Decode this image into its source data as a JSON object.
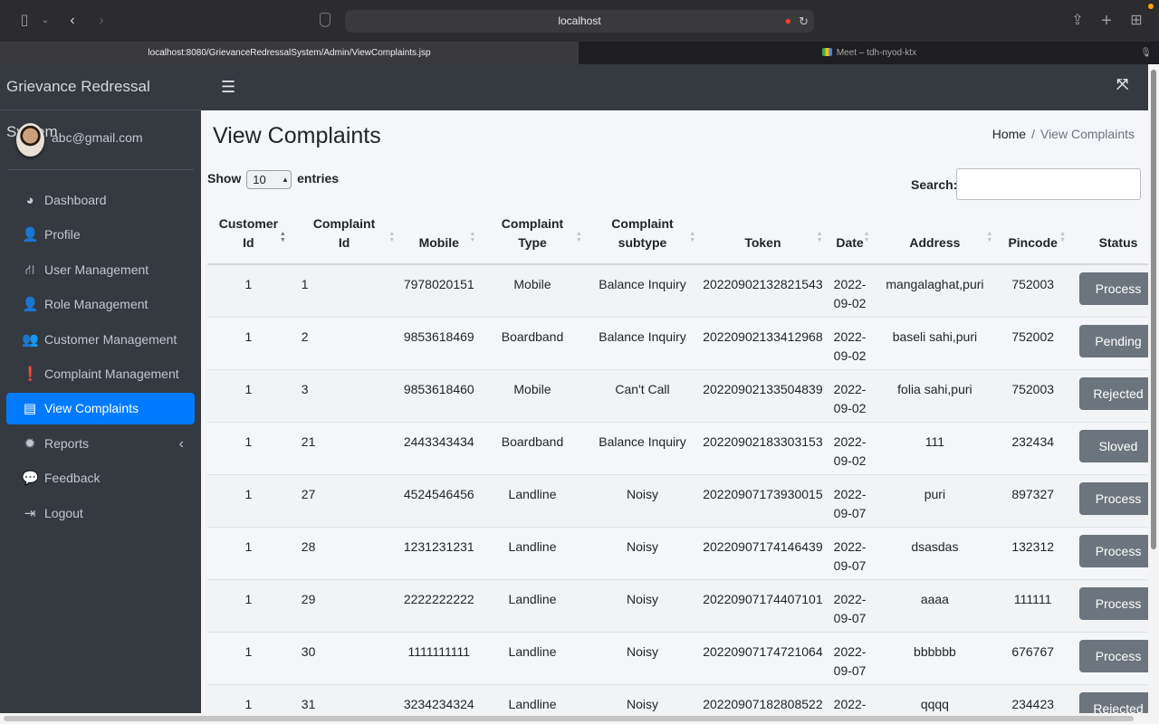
{
  "browser": {
    "url_display": "localhost",
    "active_tab": "localhost:8080/GrievanceRedressalSystem/Admin/ViewComplaints.jsp",
    "inactive_tab": "Meet – tdh-nyod-ktx"
  },
  "app": {
    "brand": "Grievance Redressal System"
  },
  "user": {
    "email": "abc@gmail.com"
  },
  "sidebar": {
    "items": [
      {
        "label": "Dashboard",
        "icon": "dashboard-icon",
        "glyph": "◕"
      },
      {
        "label": "Profile",
        "icon": "user-icon",
        "glyph": "👤"
      },
      {
        "label": "User Management",
        "icon": "sitemap-icon",
        "glyph": "⛙"
      },
      {
        "label": "Role Management",
        "icon": "user-tie-icon",
        "glyph": "👤"
      },
      {
        "label": "Customer Management",
        "icon": "users-icon",
        "glyph": "👥"
      },
      {
        "label": "Complaint Management",
        "icon": "exclamation-circle-icon",
        "glyph": "❗"
      },
      {
        "label": "View Complaints",
        "icon": "list-alt-icon",
        "glyph": "▤"
      },
      {
        "label": "Reports",
        "icon": "bug-icon",
        "glyph": "✹"
      },
      {
        "label": "Feedback",
        "icon": "comment-icon",
        "glyph": "💬"
      },
      {
        "label": "Logout",
        "icon": "sign-out-icon",
        "glyph": "⇥"
      }
    ],
    "active_index": 6
  },
  "page": {
    "title": "View Complaints",
    "breadcrumb": {
      "home": "Home",
      "current": "View Complaints",
      "separator": "/"
    }
  },
  "table_controls": {
    "show_label": "Show",
    "entries_value": "10",
    "entries_label": "entries",
    "search_label": "Search:",
    "search_value": ""
  },
  "table": {
    "columns": [
      {
        "line1": "Customer",
        "line2": "Id"
      },
      {
        "line1": "Complaint",
        "line2": "Id"
      },
      {
        "line1": "",
        "line2": "Mobile"
      },
      {
        "line1": "Complaint",
        "line2": "Type"
      },
      {
        "line1": "Complaint",
        "line2": "subtype"
      },
      {
        "line1": "",
        "line2": "Token"
      },
      {
        "line1": "",
        "line2": "Date"
      },
      {
        "line1": "",
        "line2": "Address"
      },
      {
        "line1": "",
        "line2": "Pincode"
      },
      {
        "line1": "",
        "line2": "Status"
      }
    ],
    "rows": [
      {
        "customer_id": "1",
        "complaint_id": "1",
        "mobile": "7978020151",
        "type": "Mobile",
        "subtype": "Balance Inquiry",
        "token": "20220902132821543",
        "date1": "2022-",
        "date2": "09-02",
        "address": "mangalaghat,puri",
        "pincode": "752003",
        "status": "Process"
      },
      {
        "customer_id": "1",
        "complaint_id": "2",
        "mobile": "9853618469",
        "type": "Boardband",
        "subtype": "Balance Inquiry",
        "token": "20220902133412968",
        "date1": "2022-",
        "date2": "09-02",
        "address": "baseli sahi,puri",
        "pincode": "752002",
        "status": "Pending"
      },
      {
        "customer_id": "1",
        "complaint_id": "3",
        "mobile": "9853618460",
        "type": "Mobile",
        "subtype": "Can't Call",
        "token": "20220902133504839",
        "date1": "2022-",
        "date2": "09-02",
        "address": "folia sahi,puri",
        "pincode": "752003",
        "status": "Rejected"
      },
      {
        "customer_id": "1",
        "complaint_id": "21",
        "mobile": "2443343434",
        "type": "Boardband",
        "subtype": "Balance Inquiry",
        "token": "20220902183303153",
        "date1": "2022-",
        "date2": "09-02",
        "address": "111",
        "pincode": "232434",
        "status": "Sloved"
      },
      {
        "customer_id": "1",
        "complaint_id": "27",
        "mobile": "4524546456",
        "type": "Landline",
        "subtype": "Noisy",
        "token": "20220907173930015",
        "date1": "2022-",
        "date2": "09-07",
        "address": "puri",
        "pincode": "897327",
        "status": "Process"
      },
      {
        "customer_id": "1",
        "complaint_id": "28",
        "mobile": "1231231231",
        "type": "Landline",
        "subtype": "Noisy",
        "token": "20220907174146439",
        "date1": "2022-",
        "date2": "09-07",
        "address": "dsasdas",
        "pincode": "132312",
        "status": "Process"
      },
      {
        "customer_id": "1",
        "complaint_id": "29",
        "mobile": "2222222222",
        "type": "Landline",
        "subtype": "Noisy",
        "token": "20220907174407101",
        "date1": "2022-",
        "date2": "09-07",
        "address": "aaaa",
        "pincode": "111111",
        "status": "Process"
      },
      {
        "customer_id": "1",
        "complaint_id": "30",
        "mobile": "1111111111",
        "type": "Landline",
        "subtype": "Noisy",
        "token": "20220907174721064",
        "date1": "2022-",
        "date2": "09-07",
        "address": "bbbbbb",
        "pincode": "676767",
        "status": "Process"
      },
      {
        "customer_id": "1",
        "complaint_id": "31",
        "mobile": "3234234324",
        "type": "Landline",
        "subtype": "Noisy",
        "token": "20220907182808522",
        "date1": "2022-",
        "date2": "",
        "address": "qqqq",
        "pincode": "234423",
        "status": "Rejected"
      }
    ]
  },
  "colors": {
    "sidebar_bg": "#343a40",
    "active_item": "#007bff",
    "status_button": "#6c757d",
    "content_bg": "#f4f6f9"
  }
}
